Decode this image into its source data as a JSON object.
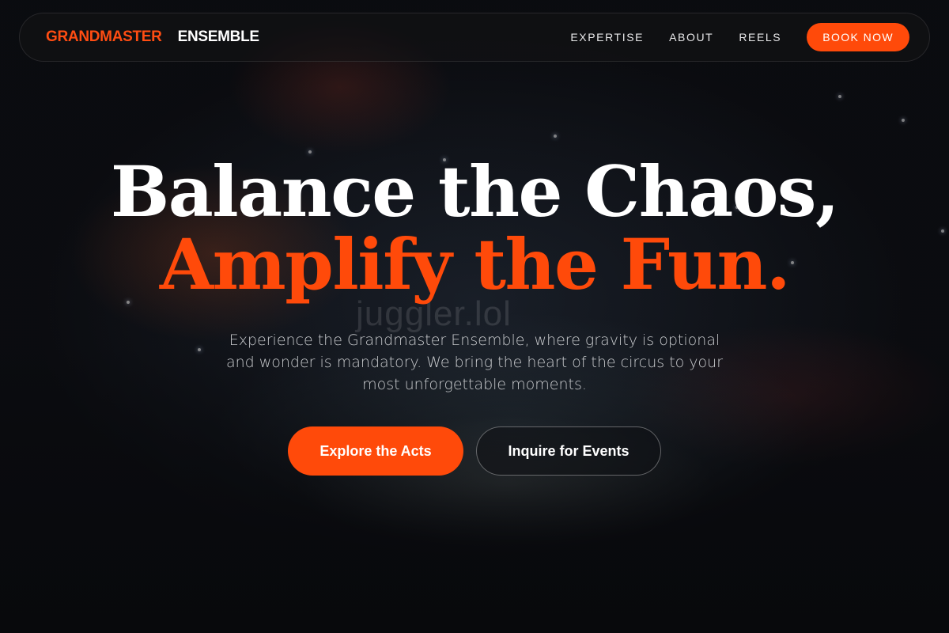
{
  "nav": {
    "brand_primary": "GRANDMASTER",
    "brand_secondary": "ENSEMBLE",
    "links": [
      "EXPERTISE",
      "ABOUT",
      "REELS"
    ],
    "cta_label": "BOOK NOW"
  },
  "hero": {
    "headline_line1": "Balance the Chaos,",
    "headline_line2": "Amplify the Fun.",
    "watermark": "juggler.lol",
    "subtext": "Experience the Grandmaster Ensemble, where gravity is optional and wonder is mandatory. We bring the heart of the circus to your most unforgettable moments.",
    "primary_cta": "Explore the Acts",
    "secondary_cta": "Inquire for Events",
    "background": "circus-arena-photo"
  },
  "colors": {
    "accent": "#ff4a0a",
    "background": "#0b0c10",
    "text": "#ffffff"
  }
}
